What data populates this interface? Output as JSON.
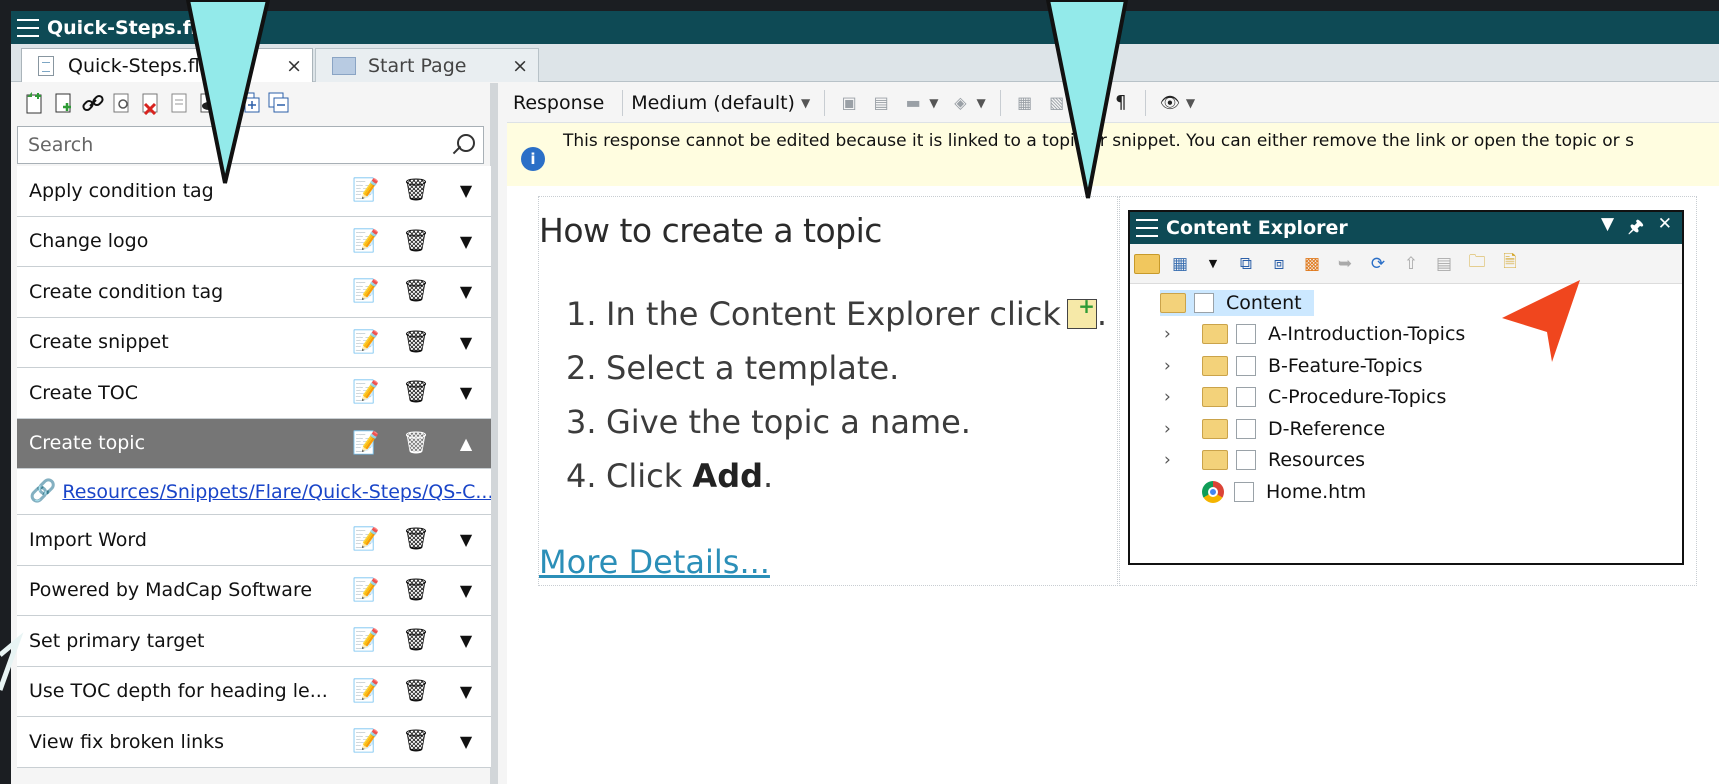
{
  "window": {
    "title": "Quick-Steps.flr"
  },
  "tabs": [
    {
      "label": "Quick-Steps.flr",
      "close": "×"
    },
    {
      "label": "Start Page",
      "close": "×"
    }
  ],
  "left": {
    "search_placeholder": "Search",
    "steps": [
      {
        "label": "Apply condition tag"
      },
      {
        "label": "Change logo"
      },
      {
        "label": "Create condition tag"
      },
      {
        "label": "Create snippet"
      },
      {
        "label": "Create TOC"
      },
      {
        "label": "Create topic",
        "selected": true
      },
      {
        "label": "Import Word"
      },
      {
        "label": "Powered by MadCap Software"
      },
      {
        "label": "Set primary target"
      },
      {
        "label": "Use TOC depth for heading le..."
      },
      {
        "label": "View fix broken links"
      }
    ],
    "link": "Resources/Snippets/Flare/Quick-Steps/QS-C..."
  },
  "right": {
    "toolbar": {
      "response_label": "Response",
      "size_value": "Medium (default)"
    },
    "info": "This response cannot be edited because it is linked to a topic or snippet. You can either remove the link or open the topic or s",
    "topic": {
      "title": "How to create a topic",
      "steps": [
        {
          "n": "1.",
          "text": "In the Content Explorer click"
        },
        {
          "n": "2.",
          "text": "Select a template."
        },
        {
          "n": "3.",
          "text": "Give the topic a name."
        },
        {
          "n": "4.",
          "text_prefix": "Click ",
          "bold": "Add",
          "suffix": "."
        }
      ],
      "more": "More Details..."
    },
    "content_explorer": {
      "title": "Content Explorer",
      "root": "Content",
      "items": [
        {
          "label": "A-Introduction-Topics",
          "type": "folder"
        },
        {
          "label": "B-Feature-Topics",
          "type": "folder"
        },
        {
          "label": "C-Procedure-Topics",
          "type": "folder"
        },
        {
          "label": "D-Reference",
          "type": "folder"
        },
        {
          "label": "Resources",
          "type": "folder"
        },
        {
          "label": "Home.htm",
          "type": "file"
        }
      ]
    }
  },
  "colors": {
    "titlebar": "#0e4a55",
    "selected_row": "#767676",
    "callout_arrow": "#93eaea",
    "pointer": "#f0461e",
    "link": "#1a45c8"
  }
}
